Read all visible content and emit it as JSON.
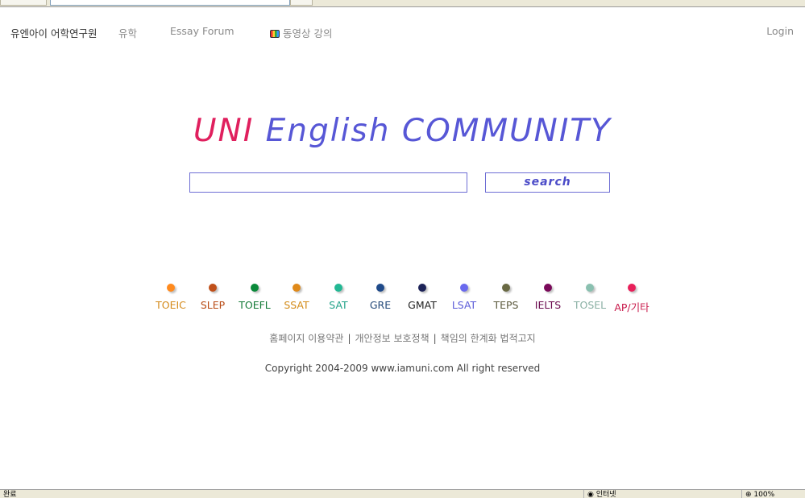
{
  "nav": {
    "brand": "유엔아이 어학연구원",
    "study_abroad": "유학",
    "essay_forum": "Essay Forum",
    "video_lecture": "동영상 강의",
    "login": "Login"
  },
  "logo": {
    "part1": "UNI",
    "part2": " English COMMUNITY"
  },
  "search": {
    "value": "",
    "button_label": "search"
  },
  "categories": [
    {
      "label": "TOEIC",
      "color": "#ff8a1e",
      "text_color": "#d48a1a"
    },
    {
      "label": "SLEP",
      "color": "#c0501a",
      "text_color": "#b84a14"
    },
    {
      "label": "TOEFL",
      "color": "#0a8a3a",
      "text_color": "#127a36"
    },
    {
      "label": "SSAT",
      "color": "#e08a1a",
      "text_color": "#d48c1a"
    },
    {
      "label": "SAT",
      "color": "#22b894",
      "text_color": "#23a38a"
    },
    {
      "label": "GRE",
      "color": "#1f4a8a",
      "text_color": "#244a7a"
    },
    {
      "label": "GMAT",
      "color": "#1d2358",
      "text_color": "#222"
    },
    {
      "label": "LSAT",
      "color": "#6a6aee",
      "text_color": "#5c5cd8"
    },
    {
      "label": "TEPS",
      "color": "#6a6a44",
      "text_color": "#5c5a3e"
    },
    {
      "label": "IELTS",
      "color": "#7a0a5a",
      "text_color": "#6a0a4e"
    },
    {
      "label": "TOSEL",
      "color": "#8ac0b0",
      "text_color": "#8ab0a4"
    },
    {
      "label": "AP/기타",
      "color": "#e8205a",
      "text_color": "#c8184a"
    }
  ],
  "footer": {
    "terms": "홈페이지 이용약관",
    "privacy": "개안정보 보호정책",
    "disclaimer": "책임의 한계화 법적고지",
    "separator": "|",
    "copyright": "Copyright 2004-2009 www.iamuni.com All right reserved"
  },
  "status": {
    "left": "완료",
    "zone": "인터넷",
    "zoom": "100%"
  }
}
